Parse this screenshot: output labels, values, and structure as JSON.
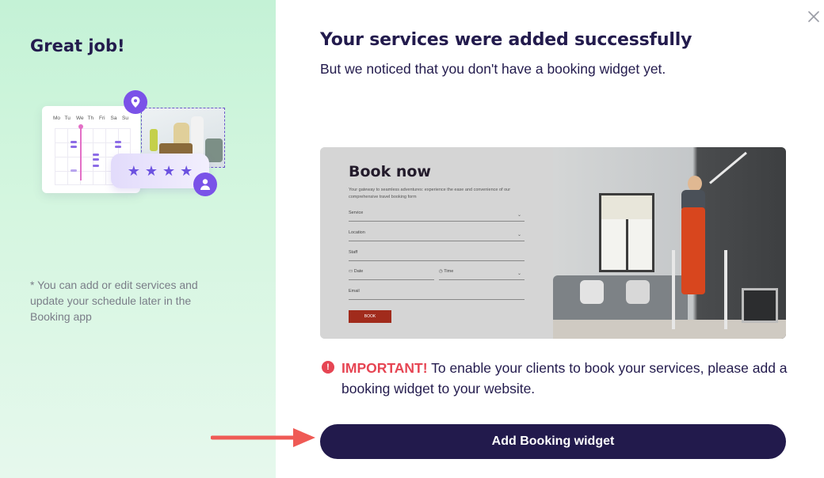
{
  "left_panel": {
    "heading": "Great job!",
    "note": "* You can add or edit services and update your schedule later in the Booking app",
    "illustration": {
      "weekdays": [
        "Mo",
        "Tu",
        "We",
        "Th",
        "Fri",
        "Sa",
        "Su"
      ],
      "rating_stars": 4,
      "icons": [
        "location-pin-icon",
        "user-icon",
        "star-icon"
      ]
    }
  },
  "dialog": {
    "close_icon": "close-icon",
    "title": "Your services were added successfully",
    "subtitle": "But we noticed that you don't have a booking widget yet."
  },
  "preview": {
    "heading": "Book now",
    "description": "Your gateway to seamless adventures: experience the ease and convenience of our comprehensive travel booking form",
    "fields": {
      "service": "Service",
      "location": "Location",
      "staff": "Staff",
      "date": "Date",
      "time": "Time",
      "email": "Email"
    },
    "button": "BOOK"
  },
  "important": {
    "icon": "alert-circle-icon",
    "lead": "IMPORTANT!",
    "text": " To enable your clients to book your services, please add a booking widget to your website."
  },
  "cta": {
    "label": "Add Booking widget",
    "arrow_icon": "arrow-right-icon"
  },
  "colors": {
    "primary": "#221a4c",
    "alert": "#e64553",
    "accent": "#7a52e8",
    "left_panel_bg": "#c4f2d6"
  }
}
